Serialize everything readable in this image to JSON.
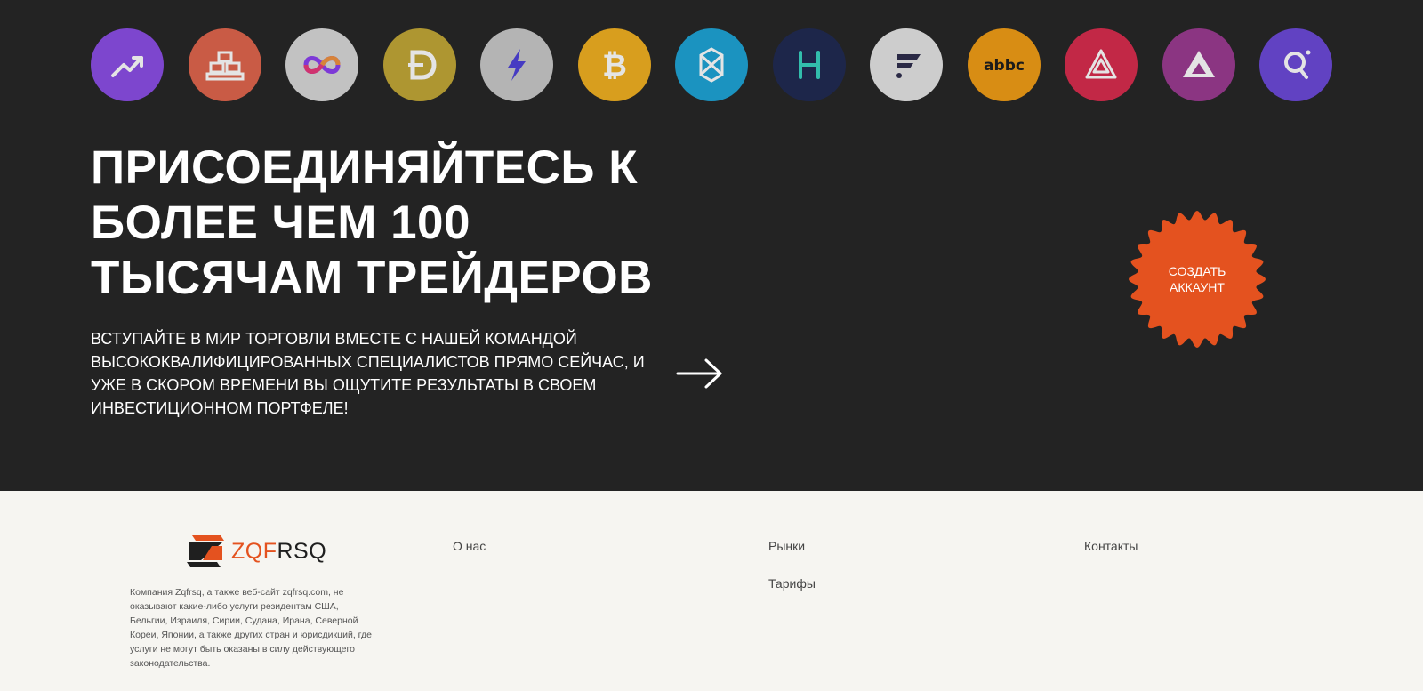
{
  "hero": {
    "coins": [
      {
        "name": "chart-up-icon",
        "bg": "#8a4be6"
      },
      {
        "name": "gold-bars-icon",
        "bg": "#e0634a"
      },
      {
        "name": "infinity-icon",
        "bg": "#d8d8d8"
      },
      {
        "name": "dogecoin-icon",
        "bg": "#c2a633"
      },
      {
        "name": "lightning-icon",
        "bg": "#c9c9c9"
      },
      {
        "name": "bitcoin-icon",
        "bg": "#f2b01e"
      },
      {
        "name": "fantom-icon",
        "bg": "#1ba3d6"
      },
      {
        "name": "harmony-icon",
        "bg": "#1d2750"
      },
      {
        "name": "flux-icon",
        "bg": "#e5e5e5"
      },
      {
        "name": "abbc-icon",
        "bg": "#f29c12"
      },
      {
        "name": "arcblock-icon",
        "bg": "#d8294b"
      },
      {
        "name": "alchemy-icon",
        "bg": "#9a3890"
      },
      {
        "name": "quant-icon",
        "bg": "#6a47d9"
      }
    ],
    "headline": [
      "ПРИСОЕДИНЯЙТЕСЬ К",
      "БОЛЕЕ ЧЕМ 100",
      "ТЫСЯЧАМ ТРЕЙДЕРОВ"
    ],
    "subtitle": "ВСТУПАЙТЕ В МИР ТОРГОВЛИ ВМЕСТЕ С НАШЕЙ КОМАНДОЙ ВЫСОКОКВАЛИФИЦИРОВАННЫХ СПЕЦИАЛИСТОВ ПРЯМО СЕЙЧАС, И УЖЕ В СКОРОМ ВРЕМЕНИ ВЫ ОЩУТИТЕ РЕЗУЛЬТАТЫ В СВОЕМ ИНВЕСТИЦИОННОМ ПОРТФЕЛЕ!",
    "cta_label": "СОЗДАТЬ АККАУНТ",
    "cta_color": "#e4521f"
  },
  "footer": {
    "logo_zqf": "ZQF",
    "logo_rsq": "RSQ",
    "disclaimer": "Компания Zqfrsq, а также веб-сайт zqfrsq.com, не оказывают какие-либо услуги резидентам США, Бельгии, Израиля, Сирии, Судана, Ирана, Северной Кореи, Японии, а также других стран и юрисдикций, где услуги не могут быть оказаны в силу действующего законодательства.",
    "links": {
      "about": "О нас",
      "markets": "Рынки",
      "tariffs": "Тарифы",
      "contacts": "Контакты"
    }
  },
  "colors": {
    "hero_bg": "#232323",
    "footer_bg": "#f6f5f1",
    "accent": "#e4521f"
  }
}
